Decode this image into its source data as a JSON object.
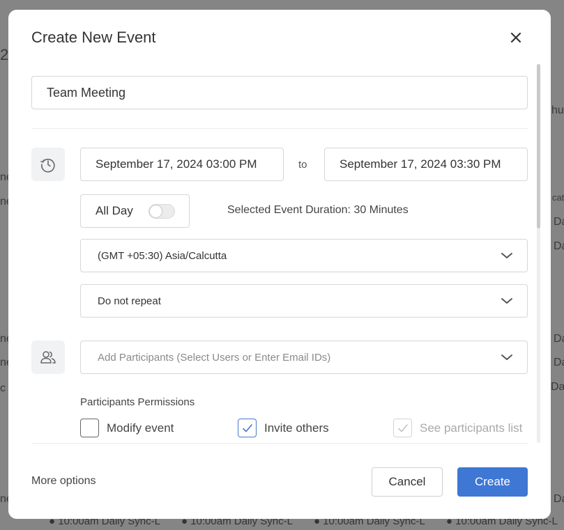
{
  "background": {
    "fragments": [
      "2",
      "hu",
      "ne",
      "ne",
      "Da",
      "Da",
      "cat",
      "ne",
      "ne",
      "c c",
      "Da",
      "Da",
      "Dai",
      "ne",
      "Da"
    ],
    "bottom_events": [
      "● 10:00am Daily Sync-L",
      "● 10:00am Daily Sync-L",
      "● 10:00am Daily Sync-L",
      "● 10:00am Daily Sync-L"
    ]
  },
  "modal": {
    "title": "Create New Event",
    "close_icon": "close-icon",
    "event_title_value": "Team Meeting",
    "start_datetime": "September 17, 2024 03:00 PM",
    "to_label": "to",
    "end_datetime": "September 17, 2024 03:30 PM",
    "all_day_label": "All Day",
    "all_day_on": false,
    "duration_text": "Selected Event Duration: 30 Minutes",
    "timezone": "(GMT +05:30) Asia/Calcutta",
    "repeat": "Do not repeat",
    "participants_placeholder": "Add Participants (Select Users or Enter Email IDs)",
    "permissions_label": "Participants Permissions",
    "permissions": [
      {
        "label": "Modify event",
        "checked": false,
        "disabled": false
      },
      {
        "label": "Invite others",
        "checked": true,
        "disabled": false
      },
      {
        "label": "See participants list",
        "checked": true,
        "disabled": true
      }
    ],
    "more_options": "More options",
    "cancel_label": "Cancel",
    "create_label": "Create",
    "accent_color": "#3e77d4"
  }
}
